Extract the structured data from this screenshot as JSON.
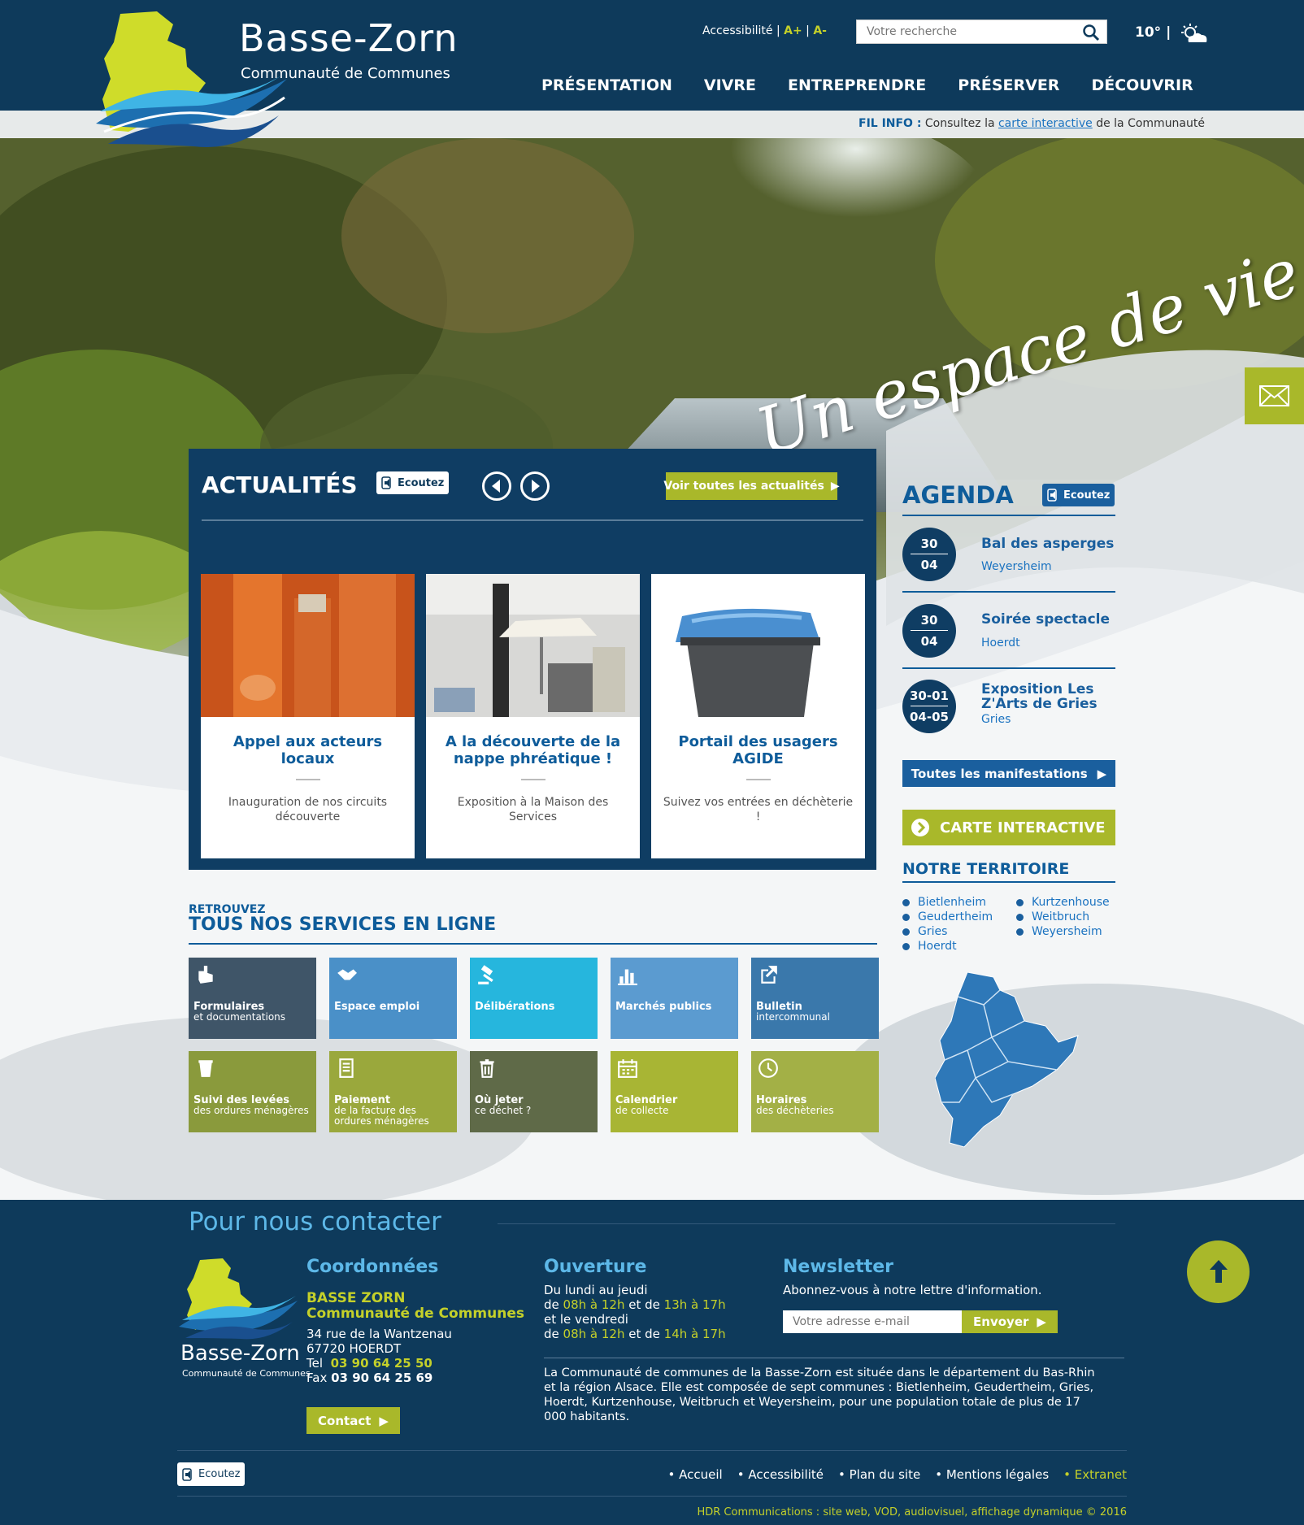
{
  "brand": {
    "title": "Basse-Zorn",
    "subtitle": "Communauté de Communes"
  },
  "top": {
    "accessibility": "Accessibilité",
    "sep": "|",
    "font_plus": "A+",
    "font_minus": "A-",
    "search_placeholder": "Votre recherche",
    "temperature": "10°",
    "weather_sep": "|"
  },
  "nav": [
    "PRÉSENTATION",
    "VIVRE",
    "ENTREPRENDRE",
    "PRÉSERVER",
    "DÉCOUVRIR"
  ],
  "filinfo": {
    "label": "FIL INFO :",
    "before": "Consultez la",
    "link": "carte interactive",
    "after": "de la Communauté"
  },
  "hero": {
    "slogan": "Un espace de vie"
  },
  "actualites": {
    "title": "ACTUALITÉS",
    "ecoutez": "Ecoutez",
    "all_label": "Voir toutes les actualités",
    "cards": [
      {
        "title": "Appel aux acteurs locaux",
        "desc": "Inauguration de nos circuits découverte"
      },
      {
        "title": "A la découverte de la nappe phréatique !",
        "desc": "Exposition à la Maison des Services"
      },
      {
        "title": "Portail des usagers AGIDE",
        "desc": "Suivez vos entrées en déchèterie !"
      }
    ]
  },
  "agenda": {
    "title": "AGENDA",
    "ecoutez": "Ecoutez",
    "events": [
      {
        "d1": "30",
        "d2": "04",
        "title": "Bal des asperges",
        "place": "Weyersheim"
      },
      {
        "d1": "30",
        "d2": "04",
        "title": "Soirée spectacle",
        "place": "Hoerdt"
      },
      {
        "d1": "30-01",
        "d2": "04-05",
        "title_l1": "Exposition Les",
        "title_l2": "Z'Arts de Gries",
        "place": "Gries"
      }
    ],
    "all_label": "Toutes les manifestations"
  },
  "carte": {
    "label": "CARTE INTERACTIVE"
  },
  "territoire": {
    "title": "NOTRE TERRITOIRE",
    "col1": [
      "Bietlenheim",
      "Geudertheim",
      "Gries",
      "Hoerdt"
    ],
    "col2": [
      "Kurtzenhouse",
      "Weitbruch",
      "Weyersheim"
    ]
  },
  "services": {
    "small": "RETROUVEZ",
    "big": "TOUS NOS SERVICES EN LIGNE",
    "tiles": [
      {
        "b": "Formulaires",
        "t": "et documentations",
        "bg": "#3f5568"
      },
      {
        "b": "Espace emploi",
        "t": "",
        "bg": "#4a90c8"
      },
      {
        "b": "Délibérations",
        "t": "",
        "bg": "#26b6dd"
      },
      {
        "b": "Marchés publics",
        "t": "",
        "bg": "#5b9bd0"
      },
      {
        "b": "Bulletin",
        "t": "intercommunal",
        "bg": "#3a78ab"
      },
      {
        "b": "Suivi des levées",
        "t": "des ordures ménagères",
        "bg": "#8a9a3c"
      },
      {
        "b": "Paiement",
        "t": "de la facture des ordures ménagères",
        "bg": "#9aa83c"
      },
      {
        "b": "Où jeter",
        "t": "ce déchet ?",
        "bg": "#5f6a48"
      },
      {
        "b": "Calendrier",
        "t": "de collecte",
        "bg": "#a8b534"
      },
      {
        "b": "Horaires",
        "t": "des déchèteries",
        "bg": "#a3b046"
      }
    ]
  },
  "footer": {
    "contact_title": "Pour nous contacter",
    "brand_title": "Basse-Zorn",
    "brand_sub": "Communauté de Communes",
    "coord_title": "Coordonnées",
    "coord_name1": "BASSE ZORN",
    "coord_name2": "Communauté de Communes",
    "addr1": "34 rue de la Wantzenau",
    "addr2": "67720 HOERDT",
    "tel_label": "Tel",
    "tel": "03 90 64 25 50",
    "fax_label": "Fax",
    "fax": "03 90 64 25 69",
    "contact_btn": "Contact",
    "ouv_title": "Ouverture",
    "ouv1": "Du lundi au jeudi",
    "ouv_de": "de",
    "ouv_et": "et de",
    "ouv2a": "08h à 12h",
    "ouv2b": "13h à 17h",
    "ouv3": "et le vendredi",
    "ouv4a": "08h à 12h",
    "ouv4b": "14h à 17h",
    "news_title": "Newsletter",
    "news_text": "Abonnez-vous à notre lettre d'information.",
    "news_placeholder": "Votre adresse e-mail",
    "news_btn": "Envoyer",
    "about": "La Communauté de communes de la Basse-Zorn est située dans le département du Bas-Rhin et la région Alsace. Elle est composée de sept communes : Bietlenheim, Geudertheim, Gries, Hoerdt, Kurtzenhouse, Weitbruch et Weyersheim, pour une population totale de plus de 17 000 habitants.",
    "ecoutez": "Ecoutez",
    "links": [
      "Accueil",
      "Accessibilité",
      "Plan du site",
      "Mentions légales"
    ],
    "extranet": "Extranet",
    "credits": "HDR Communications : site web, VOD, audiovisuel, affichage dynamique © 2016"
  }
}
